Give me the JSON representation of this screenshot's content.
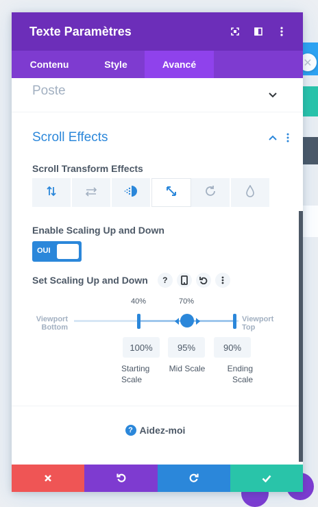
{
  "modal": {
    "title": "Texte Paramètres",
    "header_icons": [
      "focus-icon",
      "sidebar-layout-icon",
      "more-vertical-icon"
    ],
    "tabs": [
      {
        "label": "Contenu",
        "active": false
      },
      {
        "label": "Style",
        "active": false
      },
      {
        "label": "Avancé",
        "active": true
      }
    ]
  },
  "sections": {
    "poste": {
      "label": "Poste",
      "state": "collapsed"
    },
    "scroll_effects": {
      "label": "Scroll Effects",
      "state": "expanded"
    }
  },
  "scroll_transform": {
    "label": "Scroll Transform Effects",
    "effects": [
      {
        "icon": "vertical-motion-icon",
        "active": false
      },
      {
        "icon": "horizontal-motion-icon",
        "active": false
      },
      {
        "icon": "fading-icon",
        "active": false
      },
      {
        "icon": "scaling-icon",
        "active": true
      },
      {
        "icon": "rotating-icon",
        "active": false
      },
      {
        "icon": "blur-icon",
        "active": false
      }
    ]
  },
  "enable_scaling": {
    "label": "Enable Scaling Up and Down",
    "toggle_text": "OUI",
    "enabled": true
  },
  "set_scaling": {
    "label": "Set Scaling Up and Down",
    "buttons": [
      "?",
      "mobile-icon",
      "undo-icon",
      "more-vertical-icon"
    ],
    "viewport_bottom": "Viewport Bottom",
    "viewport_top": "Viewport Top",
    "marker_start": "40%",
    "marker_end": "70%",
    "starting_scale": {
      "value": "100%",
      "caption": "Starting Scale"
    },
    "mid_scale": {
      "value": "95%",
      "caption": "Mid Scale"
    },
    "ending_scale": {
      "value": "90%",
      "caption": "Ending Scale"
    }
  },
  "help": {
    "label": "Aidez-moi"
  },
  "footer": {
    "buttons": [
      {
        "name": "cancel",
        "icon": "close-icon",
        "color": "#ef5555"
      },
      {
        "name": "undo",
        "icon": "undo-icon",
        "color": "#7e3bd0"
      },
      {
        "name": "redo",
        "icon": "redo-icon",
        "color": "#2b87da"
      },
      {
        "name": "save",
        "icon": "check-icon",
        "color": "#29c4a9"
      }
    ]
  },
  "colors": {
    "header": "#6c2eb9",
    "tabs": "#7e3bd0",
    "active_tab": "#8f42ec",
    "accent": "#2b87da",
    "text": "#4c5866",
    "muted": "#a2b0c1"
  }
}
